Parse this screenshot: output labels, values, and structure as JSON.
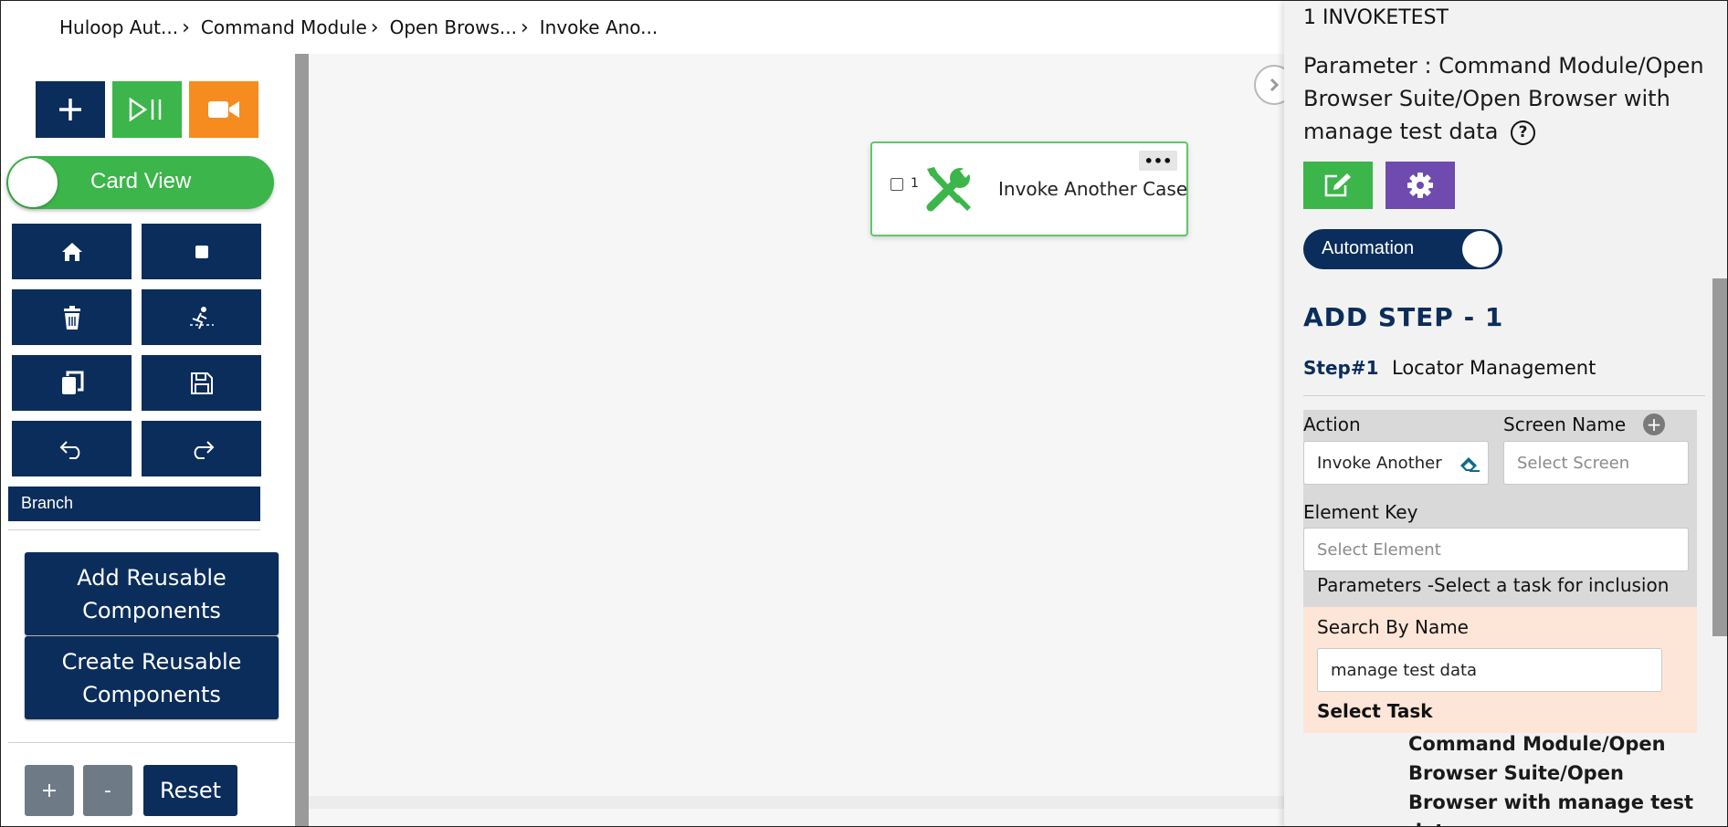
{
  "breadcrumb": [
    "Huloop Aut...",
    "Command Module",
    "Open Brows...",
    "Invoke Ano..."
  ],
  "sidebar": {
    "top_buttons": [
      {
        "name": "add",
        "icon": "plus-icon",
        "color": "#0b2d5b"
      },
      {
        "name": "play-pause",
        "icon": "play-pause-icon",
        "color": "#3cb54a"
      },
      {
        "name": "record",
        "icon": "video-camera-icon",
        "color": "#f68b1f"
      }
    ],
    "card_view_label": "Card View",
    "branch_label": "Branch",
    "add_reusable_label": "Add Reusable Components",
    "create_reusable_label": "Create Reusable Components",
    "zoom_in_label": "+",
    "zoom_out_label": "-",
    "reset_label": "Reset"
  },
  "canvas": {
    "node": {
      "number": "1",
      "label": "Invoke Another Case",
      "menu_label": "•••",
      "icon": "tools-icon"
    }
  },
  "panel": {
    "title": "1 INVOKETEST",
    "parameter": "Parameter : Command Module/Open Browser Suite/Open Browser with manage test data",
    "help_label": "?",
    "automation_label": "Automation",
    "add_step_title": "ADD STEP - 1",
    "step_number": "Step#1",
    "step_title": "Locator Management",
    "action_label": "Action",
    "action_value": "Invoke Another",
    "screen_label": "Screen Name",
    "screen_placeholder": "Select Screen",
    "element_key_label": "Element Key",
    "element_placeholder": "Select Element",
    "parameters_label": "Parameters -Select a task for inclusion",
    "search_label": "Search By Name",
    "search_value": "manage test data",
    "select_task_label": "Select Task",
    "task_lines": [
      "Command Module/Open",
      "Browser Suite/Open",
      "Browser with manage test",
      "data"
    ]
  },
  "colors": {
    "navy": "#0b2d5b",
    "green": "#3cb54a",
    "orange": "#f68b1f",
    "purple": "#6f4bb0"
  }
}
